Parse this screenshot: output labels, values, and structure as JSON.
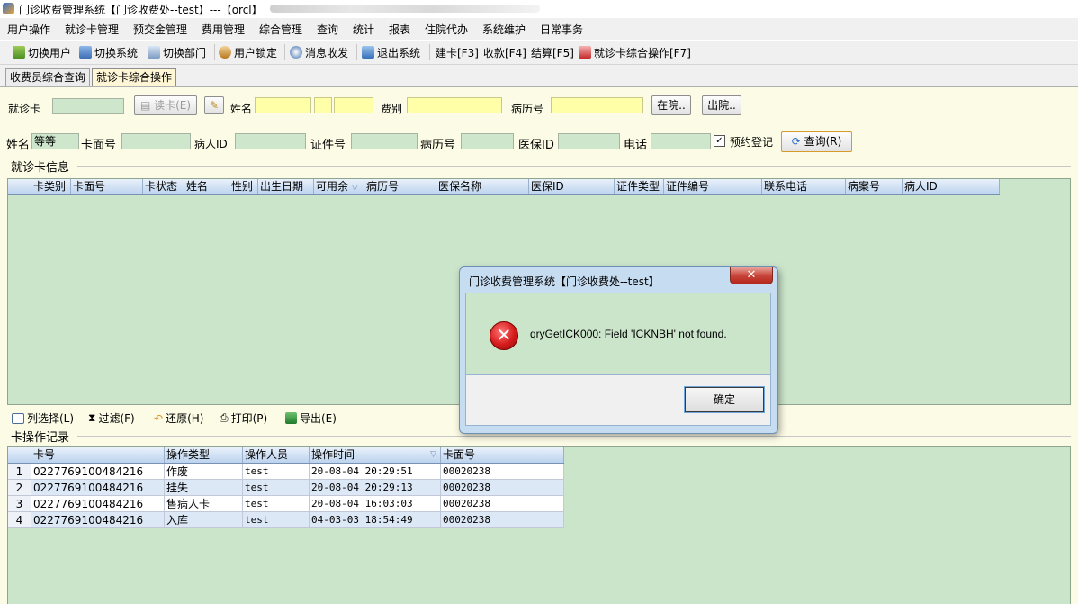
{
  "window": {
    "title": "门诊收费管理系统【门诊收费处--test】---【orcl】"
  },
  "menu": [
    "用户操作",
    "就诊卡管理",
    "预交金管理",
    "费用管理",
    "综合管理",
    "查询",
    "统计",
    "报表",
    "住院代办",
    "系统维护",
    "日常事务"
  ],
  "toolbar": {
    "switch_user": "切换用户",
    "switch_system": "切换系统",
    "switch_dept": "切换部门",
    "lock_user": "用户锁定",
    "messages": "消息收发",
    "exit": "退出系统",
    "build_card": "建卡[F3]",
    "charge": "收款[F4]",
    "settle": "结算[F5]",
    "card_ops": "就诊卡综合操作[F7]"
  },
  "tabs": [
    "收费员综合查询",
    "就诊卡综合操作"
  ],
  "form1": {
    "card_label": "就诊卡",
    "read_card_btn": "读卡(E)",
    "name_label": "姓名",
    "fee_type_label": "费别",
    "record_no_label": "病历号",
    "in_hospital_btn": "在院..",
    "discharge_btn": "出院.."
  },
  "form2": {
    "name_label": "姓名",
    "name_mode": "等等",
    "card_face_label": "卡面号",
    "patient_id_label": "病人ID",
    "cert_no_label": "证件号",
    "record_no_label": "病历号",
    "insurance_id_label": "医保ID",
    "phone_label": "电话",
    "appointment_label": "预约登记",
    "appointment_checked": true,
    "query_btn": "查询(R)"
  },
  "card_info": {
    "title": "就诊卡信息",
    "columns": [
      "卡类别",
      "卡面号",
      "卡状态",
      "姓名",
      "性别",
      "出生日期",
      "可用余",
      "病历号",
      "医保名称",
      "医保ID",
      "证件类型",
      "证件编号",
      "联系电话",
      "病案号",
      "病人ID"
    ]
  },
  "bottom_toolbar": {
    "column_select": "列选择(L)",
    "filter": "过滤(F)",
    "restore": "还原(H)",
    "print": "打印(P)",
    "export": "导出(E)"
  },
  "card_log": {
    "title": "卡操作记录",
    "columns": [
      "卡号",
      "操作类型",
      "操作人员",
      "操作时间",
      "卡面号"
    ],
    "rows": [
      {
        "num": "1",
        "card_no": "0227769100484216",
        "op_type": "作废",
        "operator": "test",
        "time": "20-08-04 20:29:51",
        "face_no": "00020238"
      },
      {
        "num": "2",
        "card_no": "0227769100484216",
        "op_type": "挂失",
        "operator": "test",
        "time": "20-08-04 20:29:13",
        "face_no": "00020238"
      },
      {
        "num": "3",
        "card_no": "0227769100484216",
        "op_type": "售病人卡",
        "operator": "test",
        "time": "20-08-04 16:03:03",
        "face_no": "00020238"
      },
      {
        "num": "4",
        "card_no": "0227769100484216",
        "op_type": "入库",
        "operator": "test",
        "time": "04-03-03 18:54:49",
        "face_no": "00020238"
      }
    ]
  },
  "dialog": {
    "title": "门诊收费管理系统【门诊收费处--test】",
    "message": "qryGetICK000: Field 'ICKNBH' not found.",
    "ok": "确定",
    "icon": "error-icon"
  },
  "colors": {
    "grid_bg": "#cbe5cb",
    "panel_bg": "#fbfbe6",
    "input_yellow": "#ffffa8",
    "header_blue": "#bcd3ee",
    "active_tab": "#fff6d6"
  }
}
